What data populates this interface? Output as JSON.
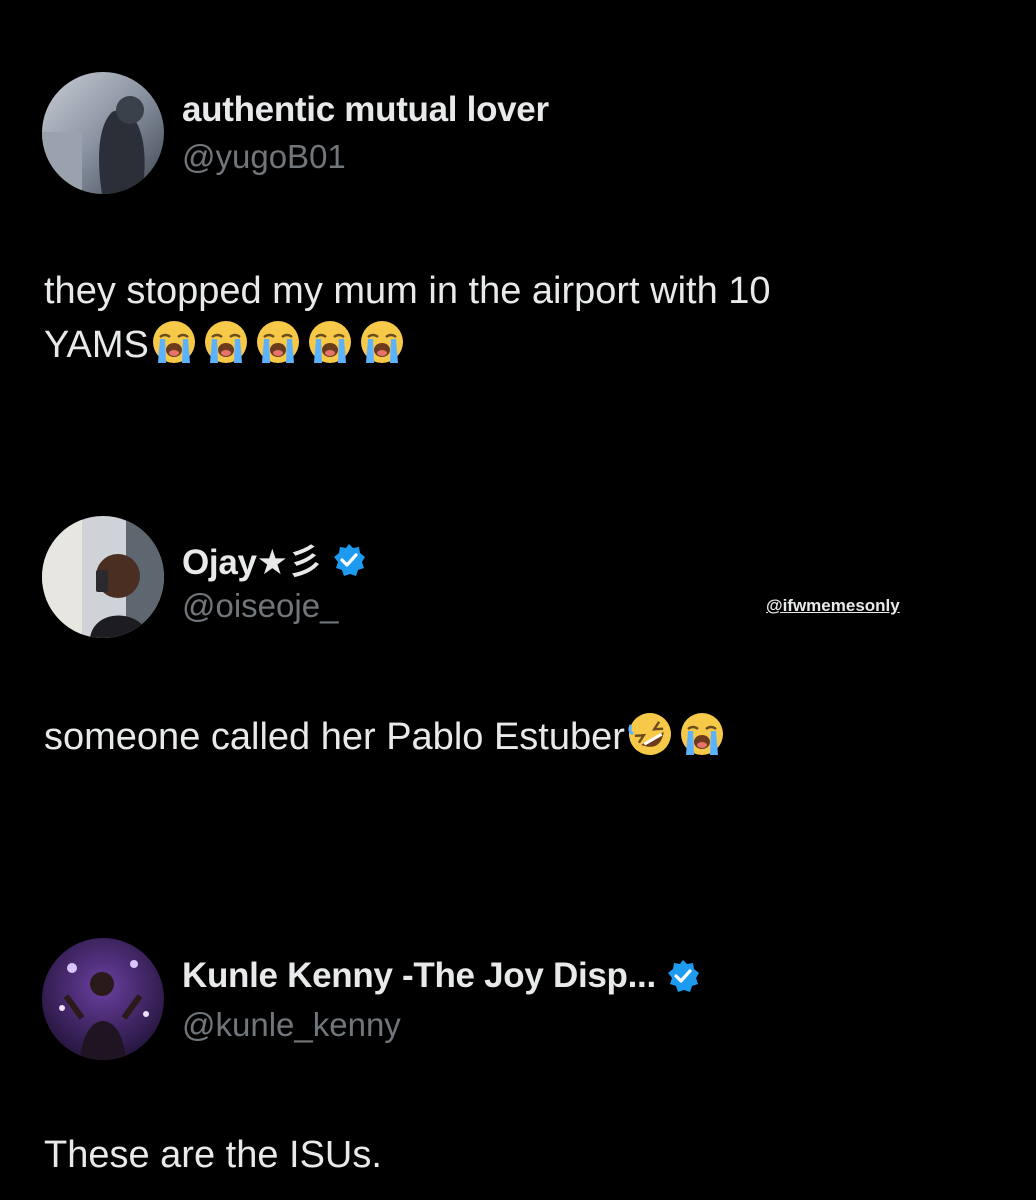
{
  "posts": [
    {
      "display_name": "authentic mutual lover",
      "handle": "@yugoB01",
      "verified": false,
      "text": "they stopped my mum in the airport with 10 YAMS",
      "text_line1": "they stopped my mum in the airport with 10",
      "text_line2": "YAMS",
      "emojis": [
        "loudly-crying-face",
        "loudly-crying-face",
        "loudly-crying-face",
        "loudly-crying-face",
        "loudly-crying-face"
      ]
    },
    {
      "display_name": "Ojay★彡",
      "handle": "@oiseoje_",
      "verified": true,
      "text": "someone called her Pablo Estuber",
      "emojis": [
        "rolling-on-floor-laughing",
        "loudly-crying-face"
      ]
    },
    {
      "display_name": "Kunle Kenny -The Joy Disp...",
      "handle": "@kunle_kenny",
      "verified": true,
      "text": "These are the ISUs."
    }
  ],
  "watermark": "@ifwmemesonly",
  "colors": {
    "background": "#000000",
    "text": "#e7e9ea",
    "handle": "#71767b",
    "verified": "#1d9bf0"
  }
}
